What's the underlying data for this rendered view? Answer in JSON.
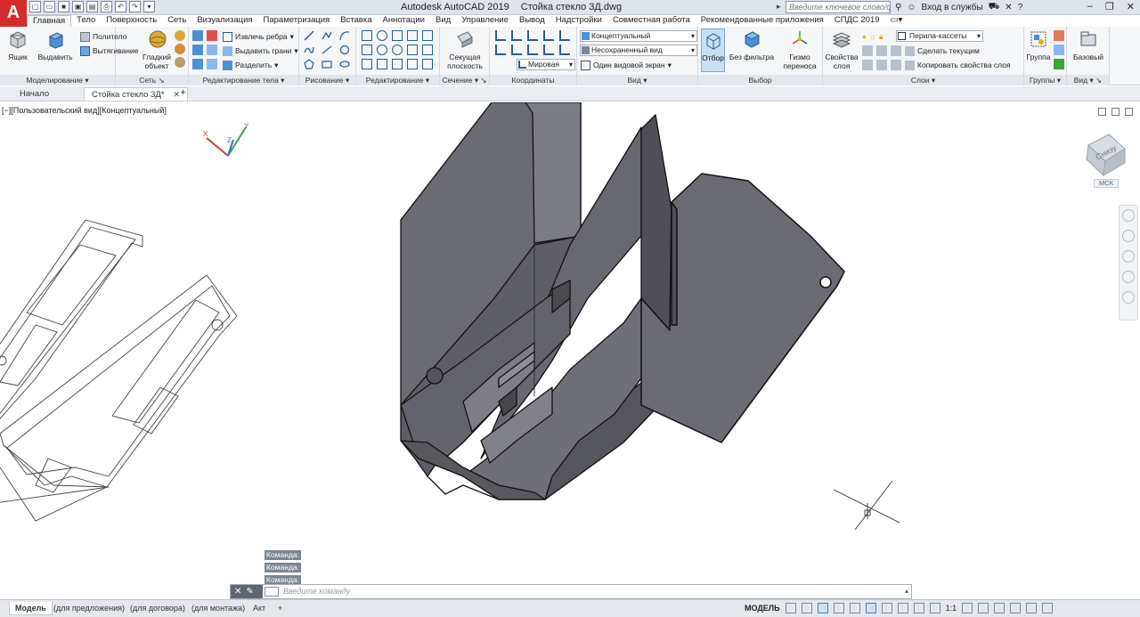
{
  "app": {
    "logo": "A",
    "title": "Autodesk AutoCAD 2019",
    "filename": "Стойка стекло 3Д.dwg"
  },
  "titlebar": {
    "search_placeholder": "Введите ключевое слово/фразу",
    "signin_label": "Вход в службы",
    "help_label": "?"
  },
  "ribbon_tabs": [
    "Главная",
    "Тело",
    "Поверхность",
    "Сеть",
    "Визуализация",
    "Параметризация",
    "Вставка",
    "Аннотации",
    "Вид",
    "Управление",
    "Вывод",
    "Надстройки",
    "Совместная работа",
    "Рекомендованные приложения",
    "СПДС 2019"
  ],
  "active_ribbon_tab": "Главная",
  "ribbon": {
    "modeling": {
      "title": "Моделирование",
      "box": "Ящик",
      "extrude": "Выдавить",
      "polysolid": "Политело",
      "presspull": "Вытягивание"
    },
    "mesh": {
      "title": "Сеть",
      "smooth_object": "Гладкий объект"
    },
    "solid_editing": {
      "title": "Редактирование тела",
      "extract_edges": "Извлечь ребра",
      "extrude_faces": "Выдавить грани",
      "separate": "Разделить"
    },
    "draw": {
      "title": "Рисование"
    },
    "modify": {
      "title": "Редактирование"
    },
    "section": {
      "title": "Сечение",
      "section_plane": "Секущая плоскость"
    },
    "coordinates": {
      "title": "Координаты",
      "ucs_combo": "Мировая"
    },
    "view": {
      "title": "Вид",
      "visual_style": "Концептуальный",
      "named_view": "Несохраненный вид",
      "viewport_config": "Один видовой экран"
    },
    "selection": {
      "title": "Выбор",
      "culling": "Отбор",
      "no_filter": "Без фильтра",
      "gizmo": "Гизмо переноса"
    },
    "layers": {
      "title": "Слои",
      "layer_properties": "Свойства слоя",
      "current_layer": "Перила-кассеты",
      "make_current": "Сделать текущим",
      "match_layer": "Копировать свойства слоя"
    },
    "groups": {
      "title": "Группы",
      "group": "Группа"
    },
    "view2": {
      "title": "Вид",
      "base": "Базовый"
    }
  },
  "doc_tabs": {
    "start": "Начало",
    "active": "Стойка стекло 3Д*"
  },
  "viewport": {
    "label": "[−][Пользовательский вид][Концептуальный]",
    "viewcube_face": "Снизу",
    "ucs_label": "МСК"
  },
  "command": {
    "history": [
      "Команда:",
      "Команда:",
      "Команда:"
    ],
    "placeholder": "Введите команду"
  },
  "status": {
    "layout_tabs": [
      "Модель",
      "(для предложения)",
      "(для договора)",
      "(для монтажа)",
      "Акт"
    ],
    "active_layout": "Модель",
    "mode": "МОДЕЛЬ",
    "scale": "1:1"
  },
  "colors": {
    "solid_dark": "#55565d",
    "solid_mid": "#6e6f77",
    "solid_light": "#85868d",
    "ribbon_bg": "#f4f6f8",
    "titlebar_bg": "#dfe3ea",
    "accent_blue": "#4c7fb3",
    "logo_red": "#d22c2c"
  }
}
